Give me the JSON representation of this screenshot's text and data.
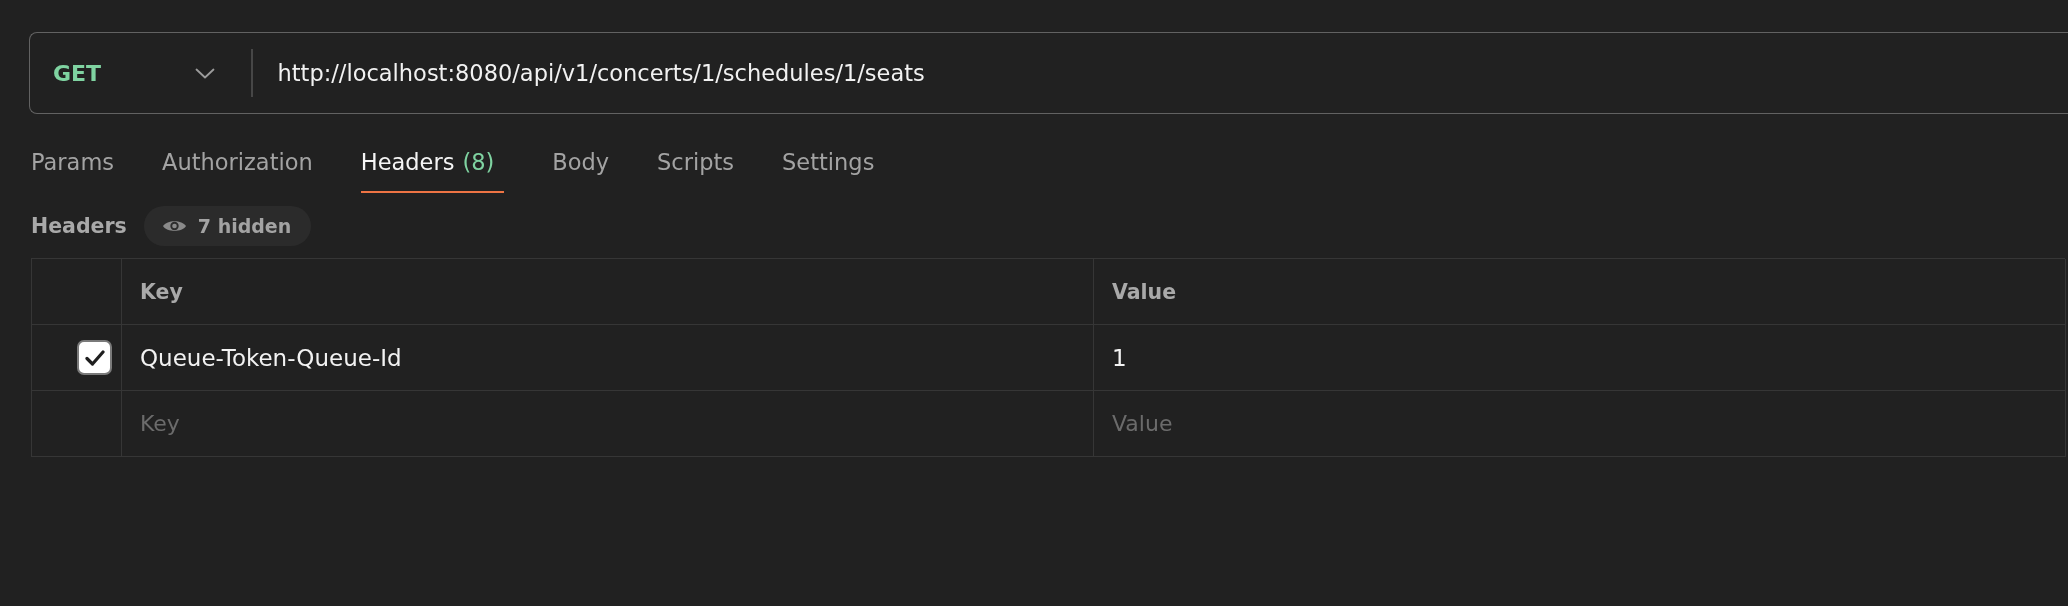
{
  "request": {
    "method": "GET",
    "url": "http://localhost:8080/api/v1/concerts/1/schedules/1/seats"
  },
  "tabs": [
    {
      "label": "Params",
      "selected": false
    },
    {
      "label": "Authorization",
      "selected": false
    },
    {
      "label": "Headers",
      "count": "(8)",
      "selected": true
    },
    {
      "label": "Body",
      "selected": false
    },
    {
      "label": "Scripts",
      "selected": false
    },
    {
      "label": "Settings",
      "selected": false
    }
  ],
  "headers": {
    "title": "Headers",
    "hidden_toggle": "7 hidden"
  },
  "table": {
    "columns": [
      "Key",
      "Value"
    ],
    "rows": [
      {
        "checked": true,
        "key": "Queue-Token-Queue-Id",
        "value": "1"
      }
    ],
    "new_row": {
      "key_placeholder": "Key",
      "value_placeholder": "Value"
    }
  }
}
